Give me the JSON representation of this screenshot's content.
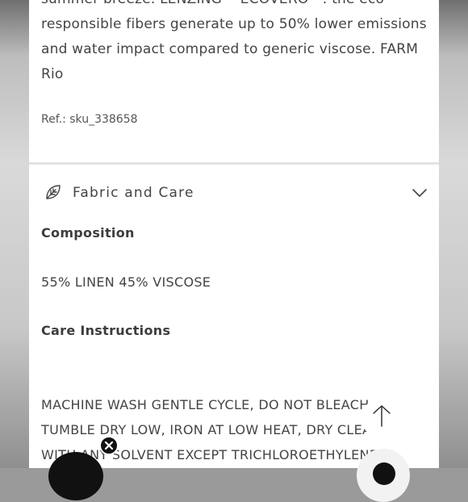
{
  "product": {
    "description_lines": [
      "summer breeze. LENZING™ ECOVERO™: the eco-",
      "responsible fibers generate up to 50% lower emissions",
      "and water impact compared to generic viscose. FARM",
      "Rio"
    ],
    "ref": "Ref.: sku_338658"
  },
  "fabric_section": {
    "title": "Fabric and Care",
    "icon": "leaf-icon",
    "toggle_icon": "chevron-down-icon",
    "composition_label": "Composition",
    "composition_value": "55% LINEN 45% VISCOSE",
    "care_label": "Care Instructions",
    "care_lines": [
      "MACHINE WASH GENTLE CYCLE, DO NOT BLEACH,",
      "TUMBLE DRY LOW, IRON AT LOW HEAT, DRY CLEAN",
      "WITH ANY SOLVENT EXCEPT TRICHLOROETHYLENE"
    ]
  },
  "floating": {
    "scroll_top_icon": "arrow-up-icon",
    "close_icon": "close-icon",
    "chat_icon": "chat-icon"
  },
  "colors": {
    "text": "#444444",
    "divider": "#e3e3e3",
    "dark": "#111111"
  }
}
